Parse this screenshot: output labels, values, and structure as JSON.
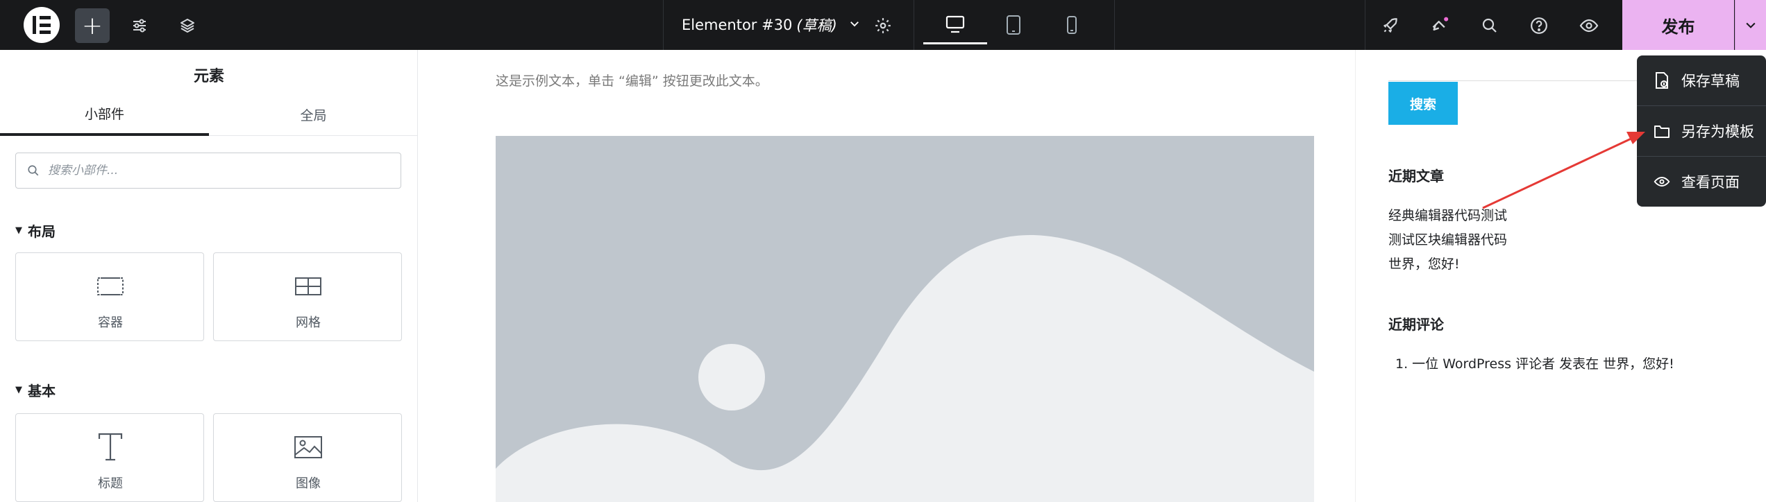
{
  "topbar": {
    "doc_title": "Elementor #30",
    "doc_status": "(草稿)",
    "publish_label": "发布"
  },
  "panel": {
    "title": "元素",
    "tabs": [
      {
        "label": "小部件"
      },
      {
        "label": "全局"
      }
    ],
    "search_placeholder": "搜索小部件...",
    "sections": [
      {
        "label": "布局",
        "widgets": [
          {
            "label": "容器",
            "icon": "container-icon"
          },
          {
            "label": "网格",
            "icon": "grid-icon"
          }
        ]
      },
      {
        "label": "基本",
        "widgets": [
          {
            "label": "标题",
            "icon": "heading-icon"
          },
          {
            "label": "图像",
            "icon": "image-icon"
          }
        ]
      }
    ]
  },
  "canvas": {
    "sample_text": "这是示例文本，单击 “编辑” 按钮更改此文本。"
  },
  "sidebar": {
    "search_button": "搜索",
    "recent_posts_heading": "近期文章",
    "recent_posts": [
      "经典编辑器代码测试",
      "测试区块编辑器代码",
      "世界，您好!"
    ],
    "recent_comments_heading": "近期评论",
    "comment": "1. 一位 WordPress 评论者 发表在 世界，您好!"
  },
  "publish_menu": {
    "items": [
      {
        "label": "保存草稿",
        "icon": "file-icon"
      },
      {
        "label": "另存为模板",
        "icon": "folder-icon"
      },
      {
        "label": "查看页面",
        "icon": "eye-icon"
      }
    ]
  },
  "colors": {
    "topbar_bg": "#18191b",
    "publish_bg": "#ebb3f1",
    "sidebar_button": "#1aaee6",
    "placeholder_bg": "#bfc6cd",
    "annotation_arrow": "#e53935"
  }
}
